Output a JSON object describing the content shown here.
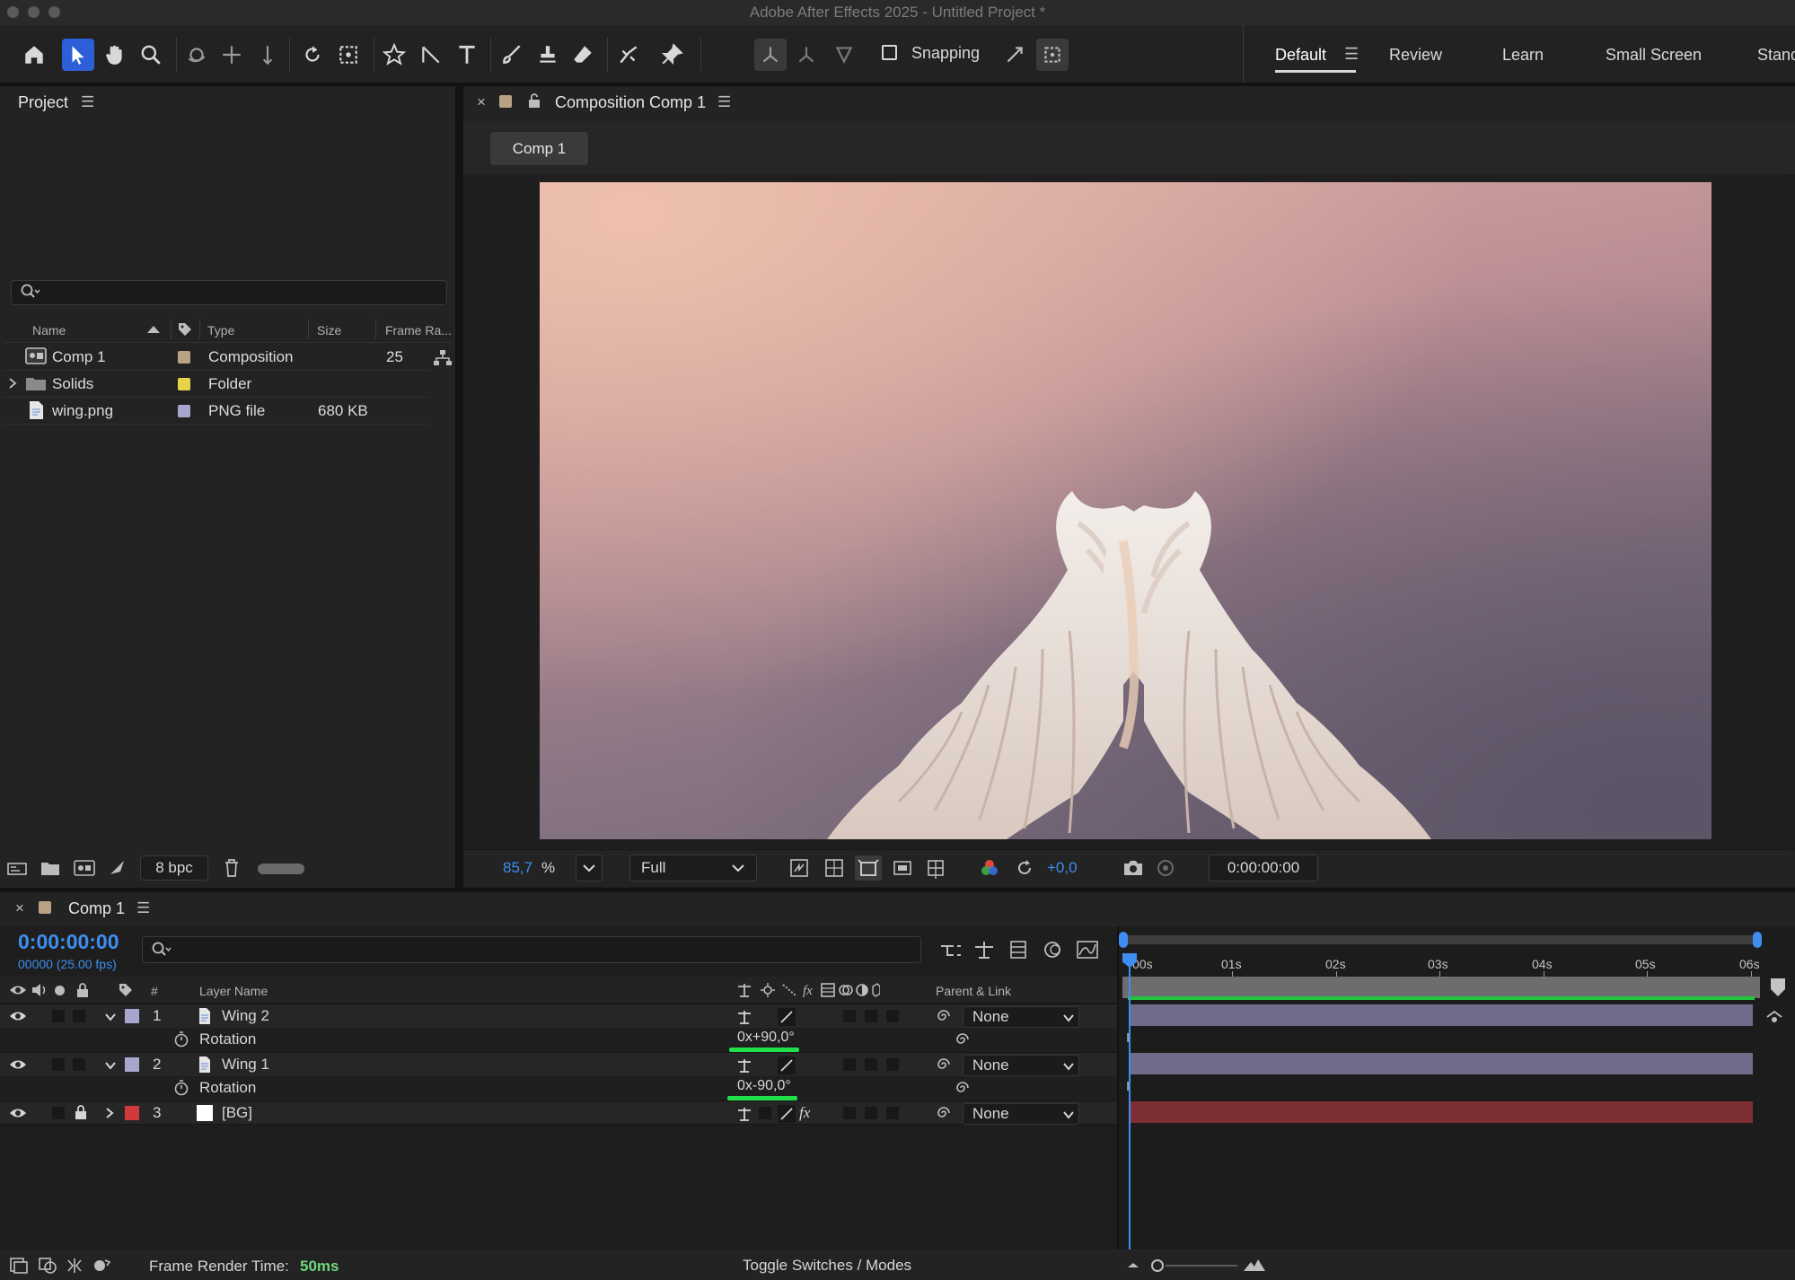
{
  "window": {
    "title": "Adobe After Effects 2025 - Untitled Project *"
  },
  "toolbar": {
    "snapping_label": "Snapping",
    "workspaces": [
      "Default",
      "Review",
      "Learn",
      "Small Screen",
      "Stand"
    ]
  },
  "project": {
    "panel_title": "Project",
    "columns": {
      "name": "Name",
      "type": "Type",
      "size": "Size",
      "frame_rate": "Frame Ra..."
    },
    "items": [
      {
        "name": "Comp 1",
        "type": "Composition",
        "size": "",
        "frame_rate": "25",
        "label_color": "#b8a283"
      },
      {
        "name": "Solids",
        "type": "Folder",
        "size": "",
        "frame_rate": "",
        "label_color": "#e8d24a"
      },
      {
        "name": "wing.png",
        "type": "PNG file",
        "size": "680 KB",
        "frame_rate": "",
        "label_color": "#a8a6cf"
      }
    ],
    "bpc": "8 bpc"
  },
  "composition": {
    "tab_title": "Composition Comp 1",
    "chip": "Comp 1",
    "zoom": "85,7",
    "zoom_unit": "%",
    "resolution": "Full",
    "exposure": "+0,0",
    "timecode": "0:00:00:00"
  },
  "timeline": {
    "tab_title": "Comp 1",
    "timecode": "0:00:00:00",
    "frames": "00000 (25.00 fps)",
    "headers": {
      "num": "#",
      "layer_name": "Layer Name",
      "parent": "Parent & Link"
    },
    "ruler": [
      "00s",
      "01s",
      "02s",
      "03s",
      "04s",
      "05s",
      "06s"
    ],
    "layers": [
      {
        "num": "1",
        "name": "Wing 2",
        "label_color": "#a8a6cf",
        "parent": "None",
        "prop_name": "Rotation",
        "prop_value": "0x+90,0°"
      },
      {
        "num": "2",
        "name": "Wing 1",
        "label_color": "#a8a6cf",
        "parent": "None",
        "prop_name": "Rotation",
        "prop_value": "0x-90,0°"
      },
      {
        "num": "3",
        "name": "[BG]",
        "label_color": "#d03a3a",
        "parent": "None"
      }
    ],
    "bar_colors": {
      "wing": "#6e6c88",
      "bg": "#7d2e34"
    }
  },
  "status": {
    "render_label": "Frame Render Time:",
    "render_value": "50ms",
    "toggle_label": "Toggle Switches / Modes"
  }
}
